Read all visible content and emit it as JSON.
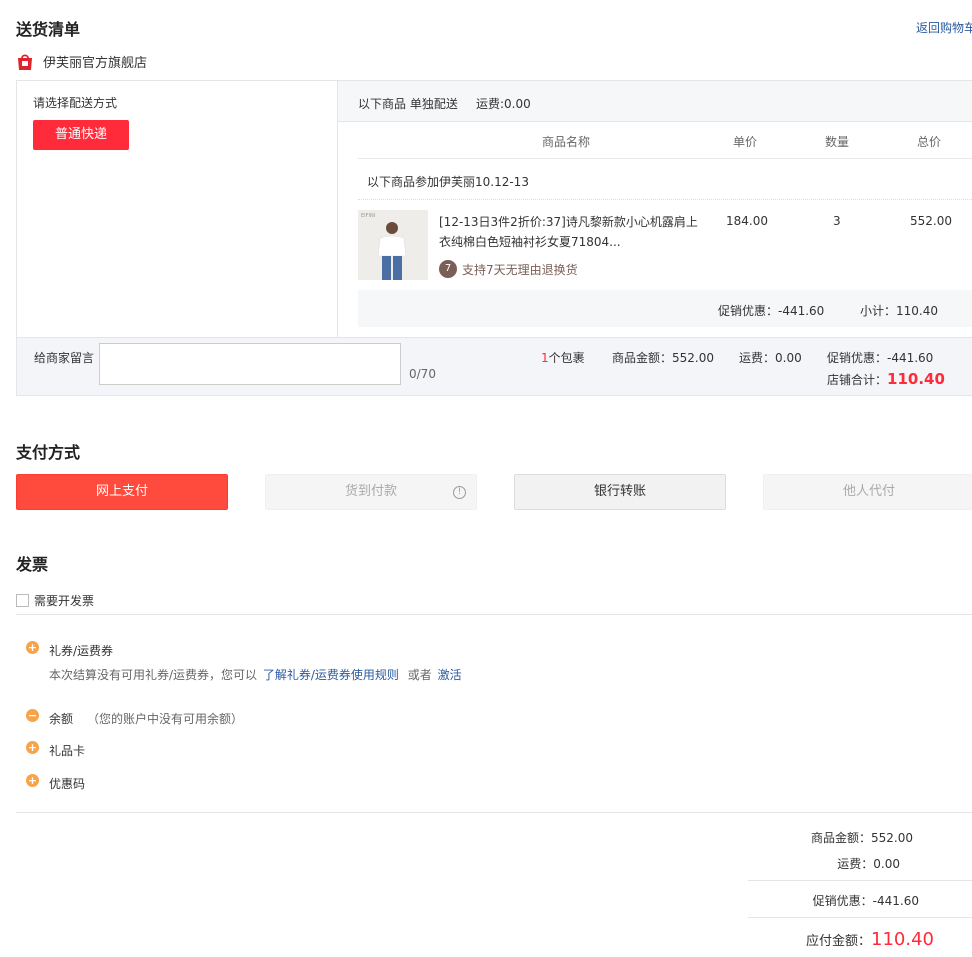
{
  "header": {
    "title": "送货清单",
    "back_link": "返回购物车"
  },
  "shop": {
    "name": "伊芙丽官方旗舰店"
  },
  "delivery": {
    "label": "请选择配送方式",
    "option": "普通快递"
  },
  "shipment": {
    "info": "以下商品 单独配送",
    "freight": "运费:0.00"
  },
  "table": {
    "headers": [
      "商品名称",
      "单价",
      "数量",
      "总价"
    ]
  },
  "promo_group": "以下商品参加伊芙丽10.12-13",
  "product": {
    "img_text": "EIFINI",
    "title_line1": "[12-13日3件2折价:37]诗凡黎新款小心机露肩上",
    "title_line2": "衣纯棉白色短袖衬衫女夏71804...",
    "service_badge": "7",
    "service": "支持7天无理由退换货",
    "price": "184.00",
    "qty": "3",
    "total": "552.00"
  },
  "subtotal": {
    "discount": "促销优惠：-441.60",
    "subtotal": "小计：110.40"
  },
  "memo": {
    "label": "给商家留言",
    "counter": "0/70"
  },
  "shop_summary": {
    "package_count": "1",
    "package_label": "个包裹",
    "goods_amount": "商品金额：552.00",
    "freight": "运费：0.00",
    "discount": "促销优惠：-441.60",
    "total_label": "店铺合计：",
    "total_value": "110.40"
  },
  "payment": {
    "title": "支付方式",
    "methods": [
      "网上支付",
      "货到付款",
      "银行转账",
      "他人代付"
    ]
  },
  "invoice": {
    "title": "发票",
    "checkbox_label": "需要开发票"
  },
  "coupons": {
    "coupon_title": "礼券/运费券",
    "coupon_desc_pre": "本次结算没有可用礼券/运费券，您可以",
    "coupon_rule_link": "了解礼券/运费券使用规则",
    "coupon_or": "或者",
    "coupon_activate": "激活",
    "balance_title": "余额",
    "balance_desc": "（您的账户中没有可用余额）",
    "giftcard_title": "礼品卡",
    "promo_code_title": "优惠码"
  },
  "summary": {
    "goods_label": "商品金额：",
    "goods_value": "552.00",
    "freight_label": "运费：",
    "freight_value": "0.00",
    "discount_label": "促销优惠：",
    "discount_value": "-441.60",
    "payable_label": "应付金额：",
    "payable_value": "110.40"
  },
  "colors": {
    "accent_red": "#ff2a3a",
    "link_blue": "#2a5ba0",
    "plus_orange": "#f7a34a"
  }
}
